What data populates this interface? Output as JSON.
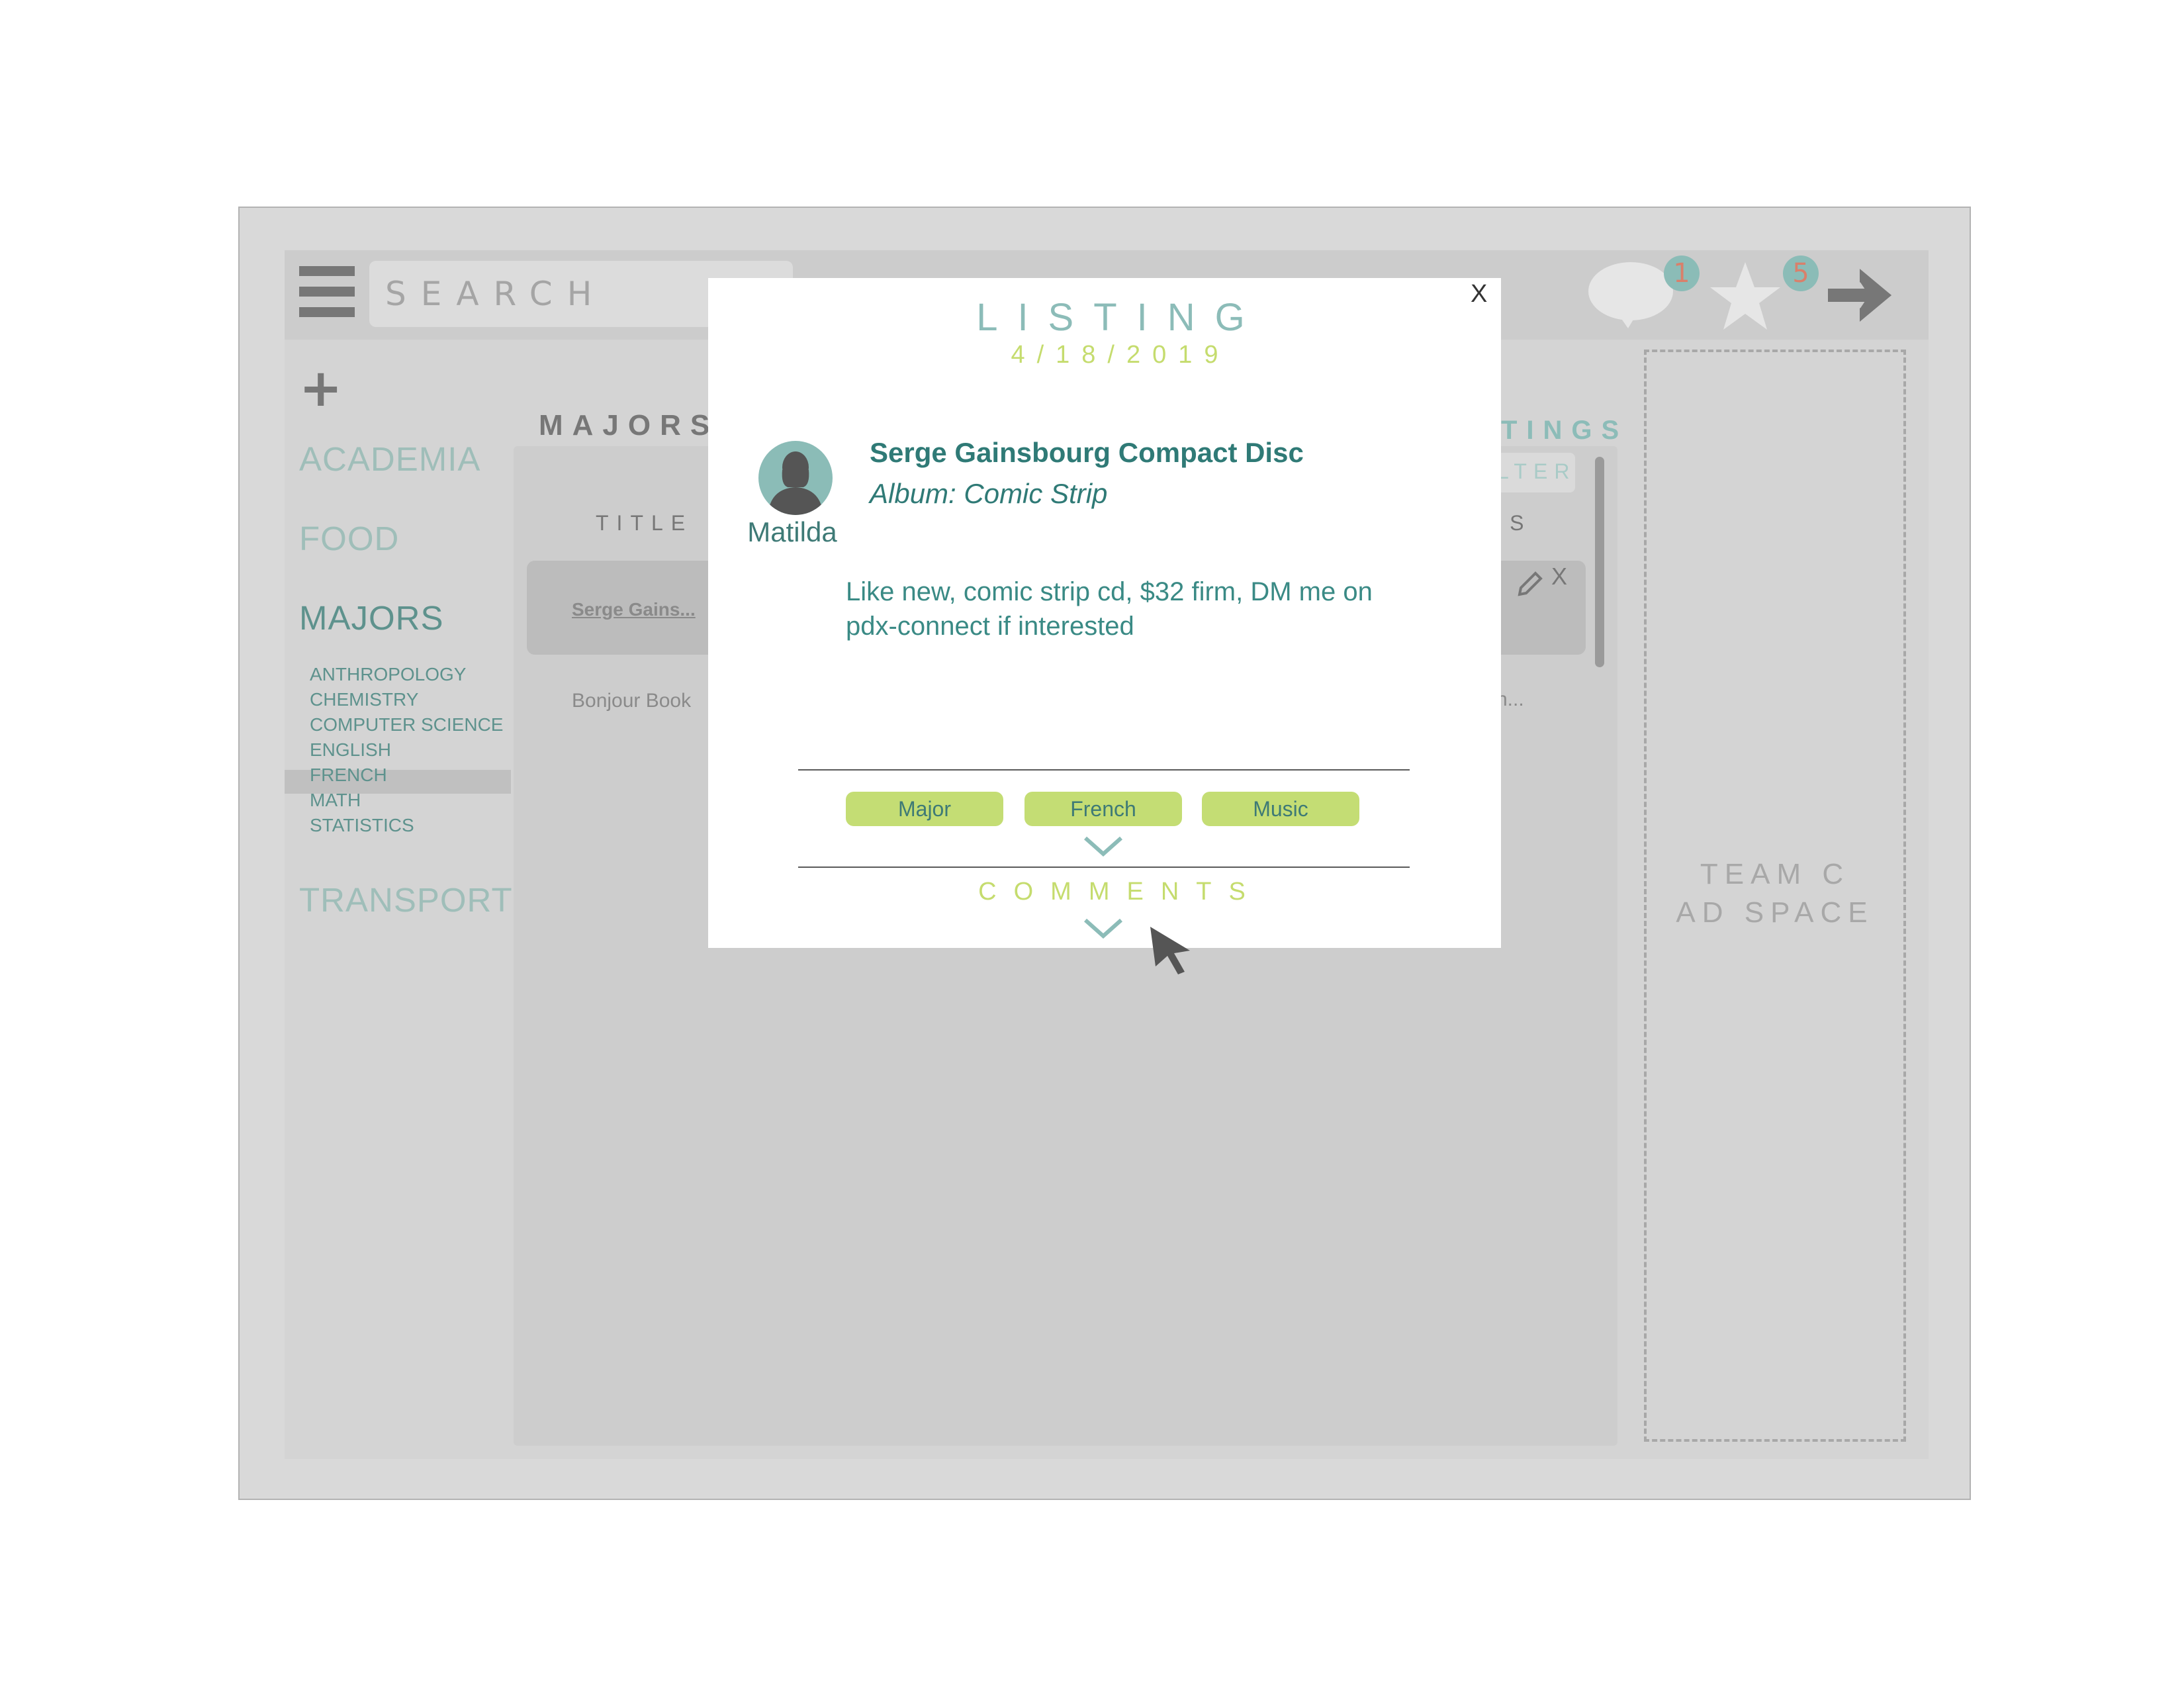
{
  "topbar": {
    "search_placeholder": "SEARCH",
    "messages_count": "1",
    "favorites_count": "5"
  },
  "sidebar": {
    "categories": [
      {
        "label": "ACADEMIA"
      },
      {
        "label": "FOOD"
      },
      {
        "label": "MAJORS"
      },
      {
        "label": "TRANSPORT"
      }
    ],
    "majors": [
      "ANTHROPOLOGY",
      "CHEMISTRY",
      "COMPUTER SCIENCE",
      "ENGLISH",
      "FRENCH",
      "MATH",
      "STATISTICS"
    ],
    "selected_major": "FRENCH"
  },
  "main": {
    "section_title": "MAJORS",
    "right_section_title_fragment": "TINGS",
    "filter_fragment": "LTER",
    "col_title": "TITLE",
    "col_right_fragment": "DS",
    "rows": [
      {
        "title": "Serge Gains...",
        "right_fragment": "."
      },
      {
        "title": "Bonjour Book",
        "right_fragment": "ch..."
      }
    ],
    "row_delete": "X"
  },
  "ad": {
    "line1": "TEAM C",
    "line2": "AD SPACE"
  },
  "modal": {
    "title": "LISTING",
    "date": "4/18/2019",
    "close": "X",
    "seller": "Matilda",
    "item_title": "Serge Gainsbourg Compact Disc",
    "item_subtitle": "Album: Comic Strip",
    "description": "Like new, comic strip cd, $32 firm, DM me on pdx-connect if interested",
    "tags": [
      "Major",
      "French",
      "Music"
    ],
    "comments_label": "COMMENTS"
  },
  "colors": {
    "teal": "#2f7a76",
    "light_teal": "#8bbcb7",
    "lime": "#c4dd74",
    "grey_bg": "#d4d4d4"
  }
}
